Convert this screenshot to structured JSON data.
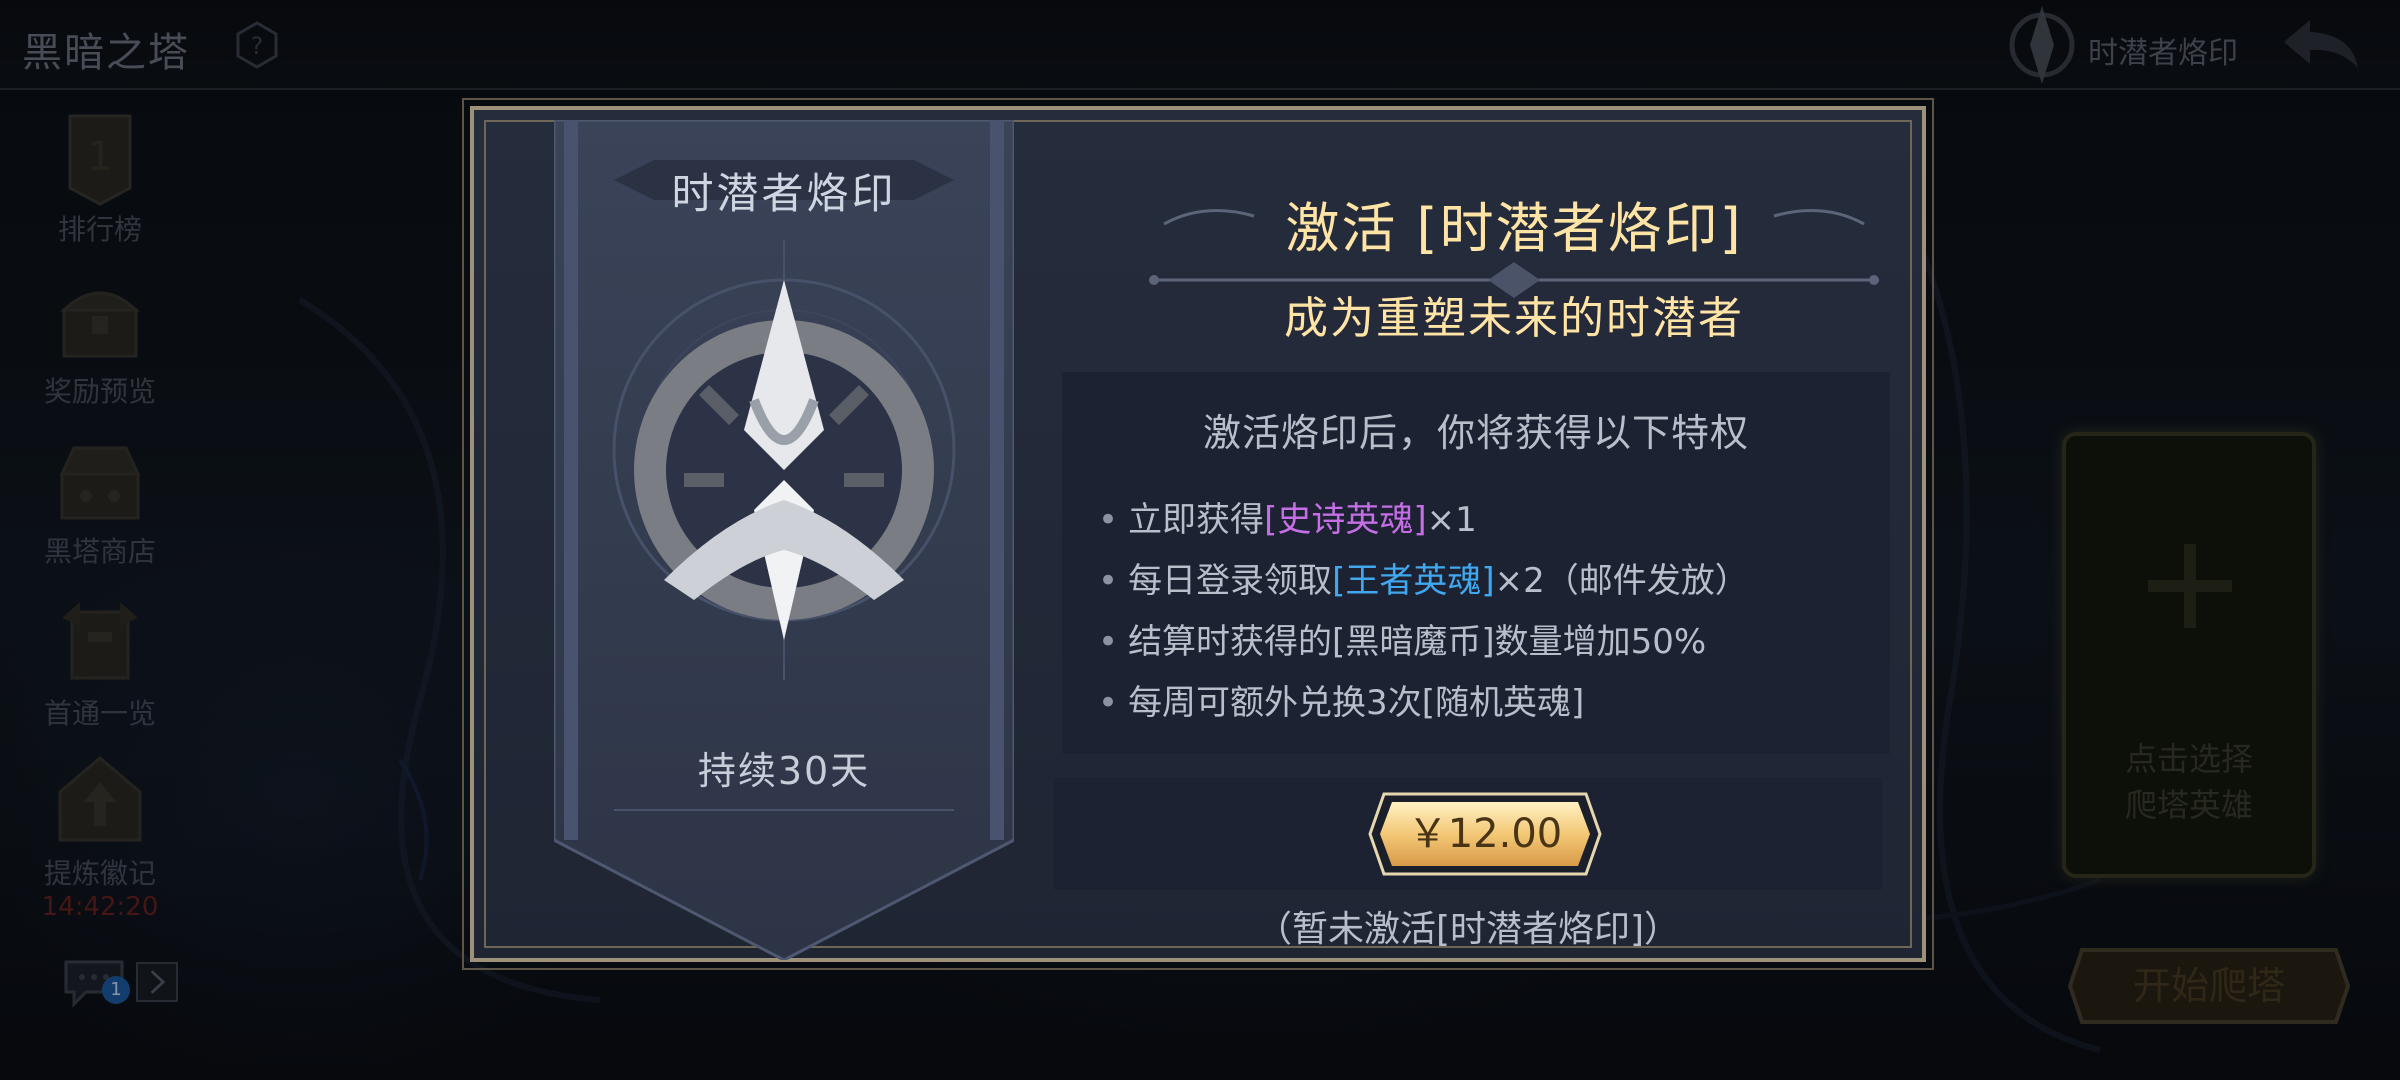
{
  "header": {
    "title": "黑暗之塔",
    "brand_label": "时潜者烙印"
  },
  "sidebar": {
    "items": [
      {
        "label": "排行榜",
        "icon": "ranking-banner-icon"
      },
      {
        "label": "奖励预览",
        "icon": "treasure-chest-icon"
      },
      {
        "label": "黑塔商店",
        "icon": "shop-chest-icon"
      },
      {
        "label": "首通一览",
        "icon": "first-clear-icon"
      },
      {
        "label": "提炼徽记",
        "icon": "refine-emblem-icon",
        "timer": "14:42:20"
      }
    ],
    "chat_badge": "1"
  },
  "right_panel": {
    "hero_slot_label_line1": "点击选择",
    "hero_slot_label_line2": "爬塔英雄",
    "start_button": "开始爬塔"
  },
  "modal": {
    "banner_title": "时潜者烙印",
    "duration": "持续30天",
    "activate_title": "激活 [时潜者烙印]",
    "activate_subtitle": "成为重塑未来的时潜者",
    "privilege_heading": "激活烙印后，你将获得以下特权",
    "privileges": [
      {
        "pre": "立即获得",
        "hl": "[史诗英魂]",
        "hl_type": "epic",
        "post": "×1"
      },
      {
        "pre": "每日登录领取",
        "hl": "[王者英魂]",
        "hl_type": "king",
        "post": "×2（邮件发放）"
      },
      {
        "pre": "结算时获得的[黑暗魔币]数量增加50%",
        "hl": "",
        "hl_type": "",
        "post": ""
      },
      {
        "pre": "每周可额外兑换3次[随机英魂]",
        "hl": "",
        "hl_type": "",
        "post": ""
      }
    ],
    "price": "￥12.00",
    "status_note": "（暂未激活[时潜者烙印]）"
  },
  "colors": {
    "gold_title": "#ffe4a6",
    "epic_purple": "#c56ee6",
    "king_blue": "#41a8ef",
    "timer_red": "#6a2320"
  }
}
